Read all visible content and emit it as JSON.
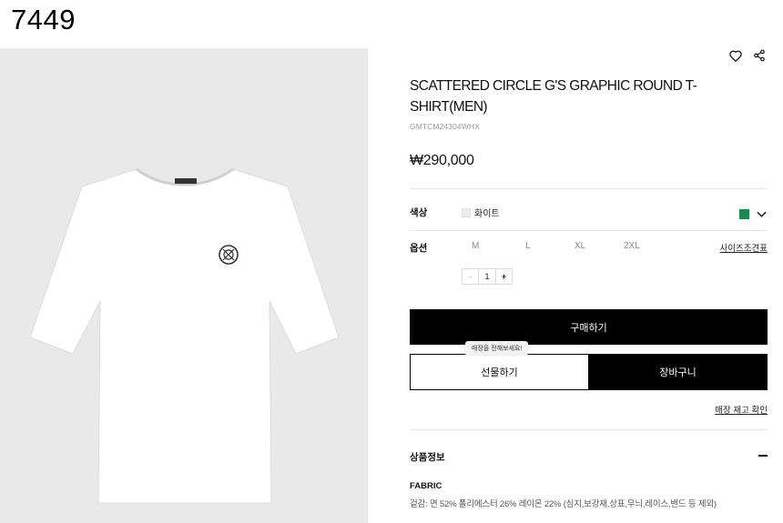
{
  "header": {
    "id_label": "7449"
  },
  "image": {
    "alt": "White round-neck T-shirt"
  },
  "icons": {
    "wishlist": "heart-icon",
    "share": "share-icon"
  },
  "product": {
    "title": "SCATTERED CIRCLE G'S GRAPHIC ROUND T-SHIRT(MEN)",
    "code": "GMTCM24304WHX",
    "price": "₩290,000"
  },
  "color_option": {
    "label": "색상",
    "selected": "화이트",
    "selected_swatch": "#eeeeee",
    "alt_swatch": "#1a8a4d"
  },
  "size_option": {
    "label": "옵션",
    "sizes": [
      "M",
      "L",
      "XL",
      "2XL"
    ],
    "size_chart_label": "사이즈조견표"
  },
  "quantity": {
    "minus": "-",
    "value": "1",
    "plus": "+"
  },
  "actions": {
    "buy": "구매하기",
    "tooltip": "매장을 전해보세요!",
    "gift": "선물하기",
    "cart": "장바구니",
    "stock_check": "매장 재고 확인"
  },
  "info": {
    "title": "상품정보",
    "toggle": "collapse",
    "fabric_label": "FABRIC",
    "fabric_desc": "겉감: 면 52% 폴리에스터 26% 레이온 22% (심지,보강재,상표,무늬,레이스,밴드 등 제외)"
  }
}
